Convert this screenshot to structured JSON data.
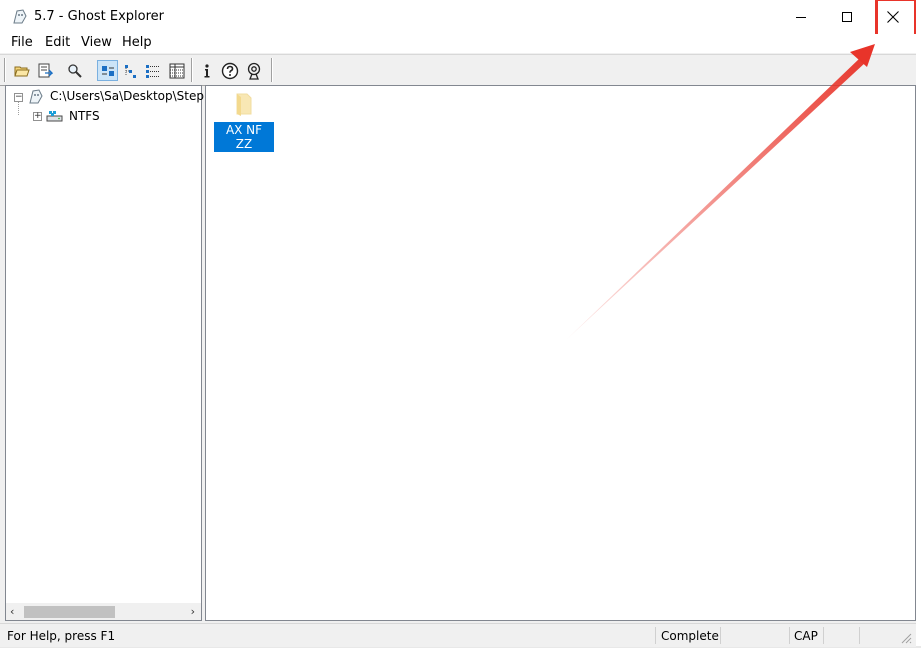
{
  "window": {
    "title": "5.7 - Ghost Explorer"
  },
  "menu": {
    "file": "File",
    "edit": "Edit",
    "view": "View",
    "help": "Help"
  },
  "toolbar": {
    "buttons": [
      "open-icon",
      "extract-icon",
      "find-icon",
      "large-icons-view-icon",
      "small-icons-view-icon",
      "list-view-icon",
      "details-view-icon",
      "info-icon",
      "help-icon",
      "about-icon"
    ],
    "active": "large-icons-view-icon"
  },
  "tree": {
    "root_path": "C:\\Users\\Sa\\Desktop\\Step",
    "child_label": "NTFS"
  },
  "content": {
    "items": [
      {
        "label": "AX NF ZZ",
        "icon": "folder-icon",
        "selected": true
      }
    ]
  },
  "status": {
    "help_text": "For Help, press F1",
    "state": "Complete",
    "cap": "CAP"
  },
  "colors": {
    "selection": "#0078d7",
    "annotation": "#e8342a"
  }
}
